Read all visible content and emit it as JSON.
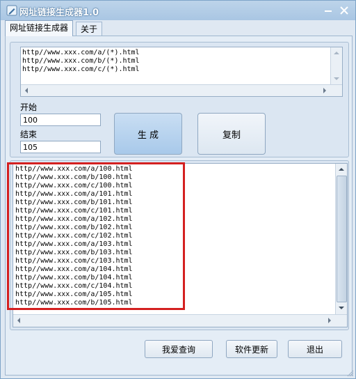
{
  "window": {
    "title": "网址链接生成器1.0"
  },
  "tabs": [
    {
      "label": "网址链接生成器"
    },
    {
      "label": "关于"
    }
  ],
  "templates": {
    "lines": [
      "http//www.xxx.com/a/(*).html",
      "http//www.xxx.com/b/(*).html",
      "http//www.xxx.com/c/(*).html"
    ]
  },
  "range": {
    "start_label": "开始",
    "start_value": "100",
    "end_label": "结束",
    "end_value": "105"
  },
  "actions": {
    "generate": "生 成",
    "copy": "复制"
  },
  "output": {
    "lines": [
      "http//www.xxx.com/a/100.html",
      "http//www.xxx.com/b/100.html",
      "http//www.xxx.com/c/100.html",
      "http//www.xxx.com/a/101.html",
      "http//www.xxx.com/b/101.html",
      "http//www.xxx.com/c/101.html",
      "http//www.xxx.com/a/102.html",
      "http//www.xxx.com/b/102.html",
      "http//www.xxx.com/c/102.html",
      "http//www.xxx.com/a/103.html",
      "http//www.xxx.com/b/103.html",
      "http//www.xxx.com/c/103.html",
      "http//www.xxx.com/a/104.html",
      "http//www.xxx.com/b/104.html",
      "http//www.xxx.com/c/104.html",
      "http//www.xxx.com/a/105.html",
      "http//www.xxx.com/b/105.html"
    ]
  },
  "footer": {
    "query": "我爱查询",
    "update": "软件更新",
    "exit": "退出"
  },
  "colors": {
    "highlight": "#d42020",
    "accent": "#a8c9ea"
  }
}
